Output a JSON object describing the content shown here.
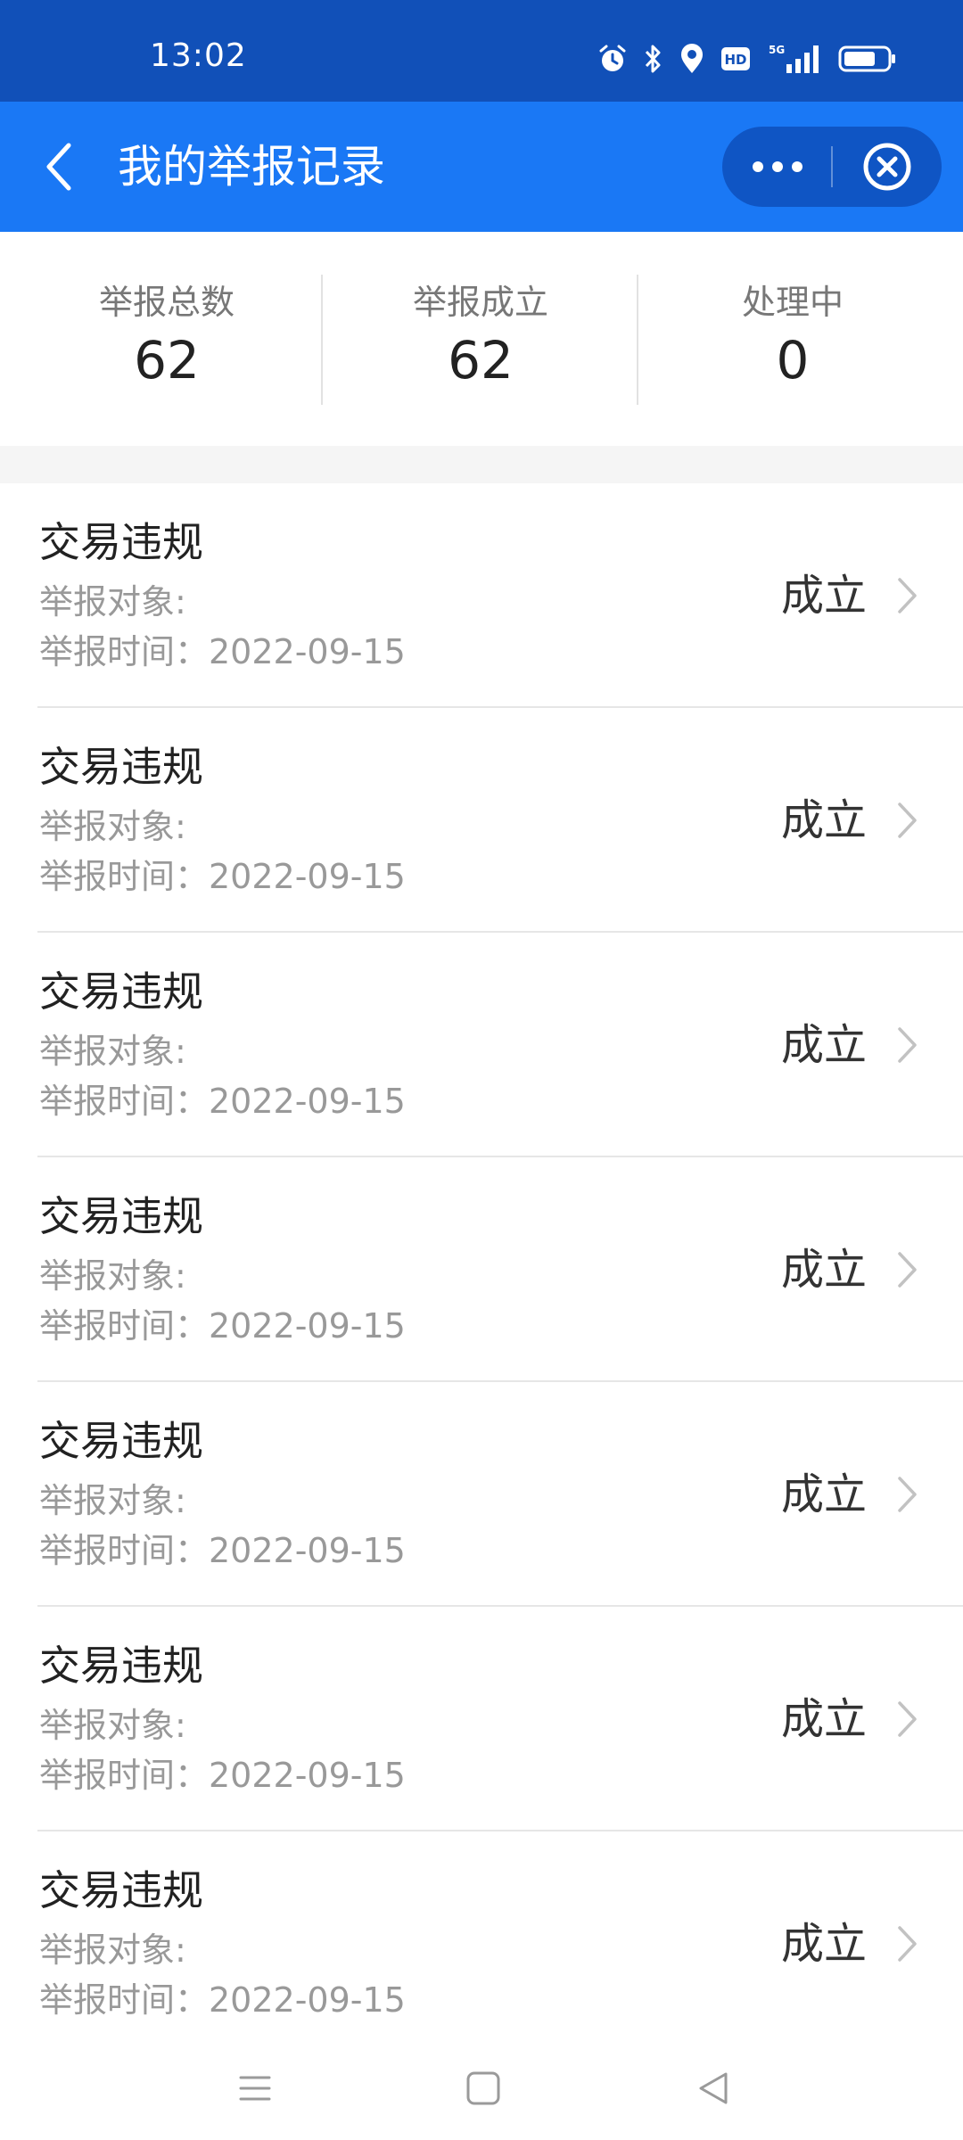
{
  "status_bar": {
    "time": "13:02",
    "icons": [
      "alarm-icon",
      "bluetooth-icon",
      "location-icon",
      "hd-icon",
      "5g-signal-icon",
      "battery-icon"
    ],
    "hd_label": "HD",
    "network_label": "5G"
  },
  "header": {
    "title": "我的举报记录",
    "back_icon": "chevron-left-icon",
    "more_icon": "more-dots-icon",
    "close_icon": "close-circle-icon"
  },
  "stats": [
    {
      "label": "举报总数",
      "value": "62"
    },
    {
      "label": "举报成立",
      "value": "62"
    },
    {
      "label": "处理中",
      "value": "0"
    }
  ],
  "records": [
    {
      "title": "交易违规",
      "target": "举报对象:",
      "time": "举报时间：2022-09-15",
      "status": "成立"
    },
    {
      "title": "交易违规",
      "target": "举报对象:",
      "time": "举报时间：2022-09-15",
      "status": "成立"
    },
    {
      "title": "交易违规",
      "target": "举报对象:",
      "time": "举报时间：2022-09-15",
      "status": "成立"
    },
    {
      "title": "交易违规",
      "target": "举报对象:",
      "time": "举报时间：2022-09-15",
      "status": "成立"
    },
    {
      "title": "交易违规",
      "target": "举报对象:",
      "time": "举报时间：2022-09-15",
      "status": "成立"
    },
    {
      "title": "交易违规",
      "target": "举报对象:",
      "time": "举报时间：2022-09-15",
      "status": "成立"
    },
    {
      "title": "交易违规",
      "target": "举报对象:",
      "time": "举报时间：2022-09-15",
      "status": "成立"
    }
  ],
  "nav_bar": {
    "icons": [
      "menu-icon",
      "home-square-icon",
      "back-triangle-icon"
    ]
  },
  "colors": {
    "status_bar_bg": "#1150b8",
    "title_bar_bg": "#1a78f5",
    "capsule_bg": "#0f55c4",
    "text_primary": "#222222",
    "text_secondary": "#999999"
  }
}
